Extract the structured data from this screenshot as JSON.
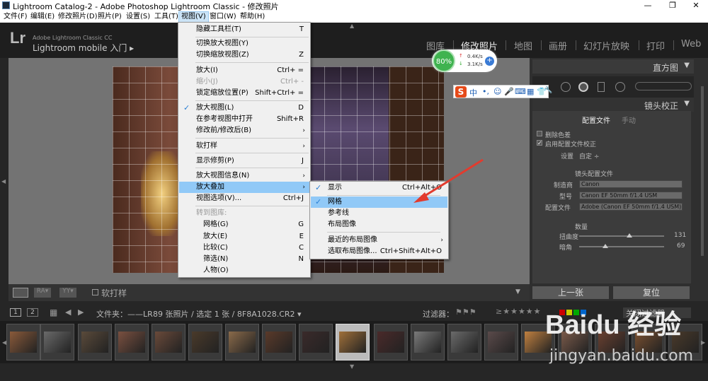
{
  "window": {
    "title": "Lightroom Catalog-2 - Adobe Photoshop Lightroom Classic - 修改照片",
    "min": "—",
    "max": "❐",
    "close": "✕"
  },
  "menubar": [
    "文件(F)",
    "编辑(E)",
    "修改照片(D)",
    "照片(P)",
    "设置(S)",
    "工具(T)",
    "视图(V)",
    "窗口(W)",
    "帮助(H)"
  ],
  "identity": {
    "logo": "Lr",
    "cc": "Adobe Lightroom Classic CC",
    "mobile": "Lightroom mobile 入门 ▸"
  },
  "modules": [
    "图库",
    "修改照片",
    "地图",
    "画册",
    "幻灯片放映",
    "打印",
    "Web"
  ],
  "view_menu": {
    "items": [
      {
        "label": "隐藏工具栏(T)",
        "shortcut": "T"
      },
      {
        "label": "切换放大视图(Y)",
        "shortcut": ""
      },
      {
        "label": "切换缩放视图(Z)",
        "shortcut": "Z"
      },
      {
        "label": "放大(I)",
        "shortcut": "Ctrl+ ="
      },
      {
        "label": "缩小(J)",
        "shortcut": "Ctrl+ -"
      },
      {
        "label": "锁定缩放位置(P)",
        "shortcut": "Shift+Ctrl+ ="
      },
      {
        "label": "放大视图(L)",
        "shortcut": "D"
      },
      {
        "label": "在参考视图中打开",
        "shortcut": "Shift+R"
      },
      {
        "label": "修改前/修改后(B)",
        "shortcut": "›"
      },
      {
        "label": "软打样",
        "shortcut": "›"
      },
      {
        "label": "显示修剪(P)",
        "shortcut": "J"
      },
      {
        "label": "放大视图信息(N)",
        "shortcut": "›"
      },
      {
        "label": "放大叠加",
        "shortcut": "›"
      },
      {
        "label": "视图选项(V)...",
        "shortcut": "Ctrl+J"
      },
      {
        "label": "转到图库:",
        "shortcut": ""
      },
      {
        "label": "网格(G)",
        "shortcut": "G"
      },
      {
        "label": "放大(E)",
        "shortcut": "E"
      },
      {
        "label": "比较(C)",
        "shortcut": "C"
      },
      {
        "label": "筛选(N)",
        "shortcut": "N"
      },
      {
        "label": "人物(O)",
        "shortcut": ""
      }
    ]
  },
  "overlay_menu": {
    "items": [
      {
        "label": "显示",
        "shortcut": "Ctrl+Alt+O"
      },
      {
        "label": "网格",
        "shortcut": ""
      },
      {
        "label": "参考线",
        "shortcut": ""
      },
      {
        "label": "布局图像",
        "shortcut": ""
      },
      {
        "label": "最近的布局图像",
        "shortcut": "›"
      },
      {
        "label": "选取布局图像...",
        "shortcut": "Ctrl+Shift+Alt+O"
      }
    ]
  },
  "netwidget": {
    "percent": "80%",
    "up": "0.4K/s",
    "down": "3.1K/s",
    "plus": "+"
  },
  "ime": {
    "s": "S",
    "zh": "中",
    "dot": "•,",
    "icons": [
      "☺",
      "🎤",
      "⌨",
      "▦",
      "👕",
      "🔧"
    ]
  },
  "right_panel": {
    "histogram": "直方图",
    "lens": "镜头校正",
    "tab_profile": "配置文件",
    "tab_manual": "手动",
    "remove_ca": "删除色差",
    "enable_profile": "启用配置文件校正",
    "setup_label": "设置",
    "setup_value": "自定 ÷",
    "lens_profile": "镜头配置文件",
    "make_label": "制造商",
    "make_value": "Canon",
    "model_label": "型号",
    "model_value": "Canon EF 50mm f/1.4 USM",
    "profile_label": "配置文件",
    "profile_value": "Adobe (Canon EF 50mm f/1.4 USM)",
    "amount": "数量",
    "distortion_label": "扭曲度",
    "distortion_value": "131",
    "vignette_label": "暗角",
    "vignette_value": "69",
    "prev": "上一张",
    "reset": "复位"
  },
  "toolbar": {
    "softproof": "软打样"
  },
  "filmbar": {
    "n1": "1",
    "n2": "2",
    "folder": "文件夹：——LR",
    "count": "89 张照片 / 选定 1 张 / 8F8A1028.CR2 ▾",
    "filter": "过滤器：",
    "filter_off": "关闭过滤器"
  },
  "watermark": {
    "brand": "Baidu 经验",
    "url": "jingyan.baidu.com"
  },
  "thumbs": [
    "#8a5a3a",
    "#6a6a6a",
    "#5a4a3a",
    "#7a5040",
    "#6a4a3a",
    "#4a3a2a",
    "#8a6a4a",
    "#5a3a2a",
    "#3a2a2a",
    "#a0703a",
    "#4a2a2a",
    "#7a7a7a",
    "#6a6a6a",
    "#5a4a4a",
    "#c08040",
    "#7a5a4a",
    "#6a4030",
    "#7a5030",
    "#4a3a2a",
    "#5a3a2a"
  ]
}
